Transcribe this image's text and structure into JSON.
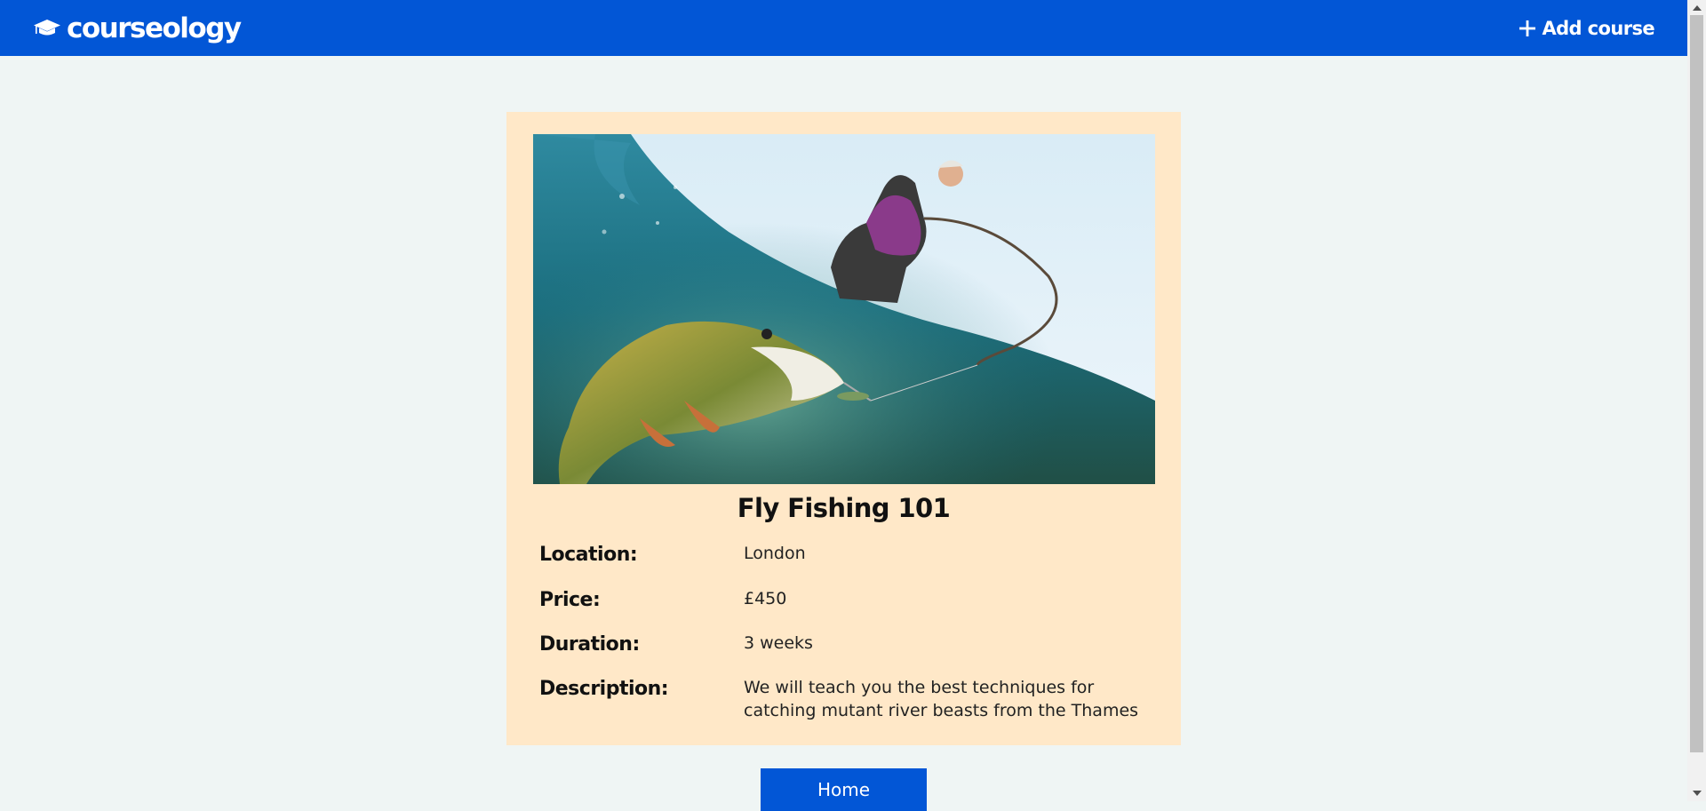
{
  "navbar": {
    "brand": "courseology",
    "brand_icon": "graduation-cap-icon",
    "add_course_label": "Add course",
    "add_course_icon": "plus-icon",
    "color": "#0256d6"
  },
  "course": {
    "title": "Fly Fishing 101",
    "image_alt": "Angler reeling in a pike fish underwater",
    "details": [
      {
        "label": "Location:",
        "value": "London"
      },
      {
        "label": "Price:",
        "value": "£450"
      },
      {
        "label": "Duration:",
        "value": "3 weeks"
      },
      {
        "label": "Description:",
        "value": "We will teach you the best techniques for catching mutant river beasts from the Thames"
      }
    ]
  },
  "home_button": {
    "label": "Home"
  },
  "colors": {
    "background": "#eff5f4",
    "card": "#ffe8c8",
    "accent": "#0256d6"
  }
}
